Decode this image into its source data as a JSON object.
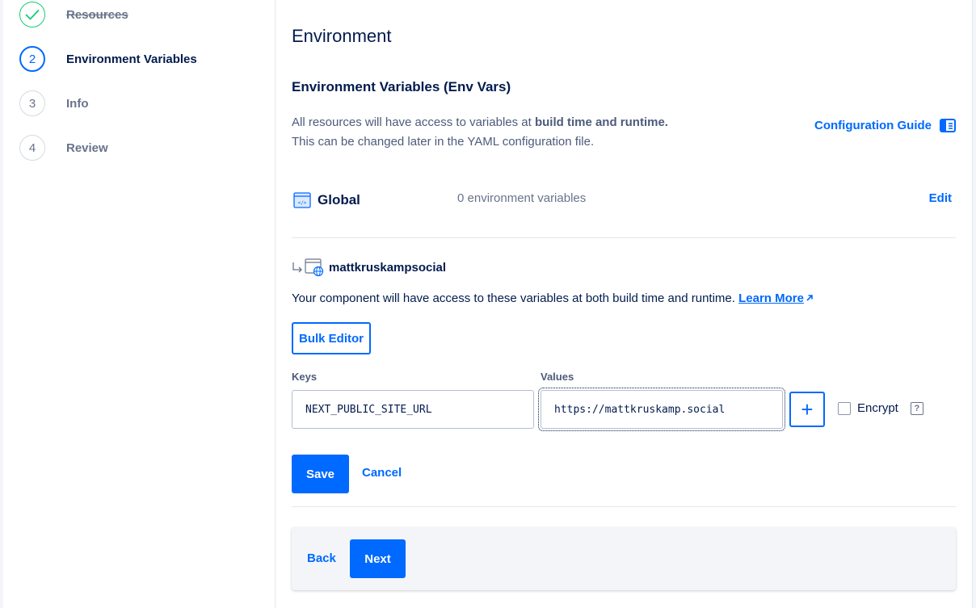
{
  "steps": [
    {
      "label": "Resources",
      "state": "done"
    },
    {
      "number": "2",
      "label": "Environment Variables",
      "state": "active"
    },
    {
      "number": "3",
      "label": "Info",
      "state": "pending"
    },
    {
      "number": "4",
      "label": "Review",
      "state": "pending"
    }
  ],
  "page": {
    "title": "Environment",
    "section_title": "Environment Variables (Env Vars)",
    "desc_prefix": "All resources will have access to variables at ",
    "desc_bold": "build time and runtime.",
    "desc_line2": "This can be changed later in the YAML configuration file.",
    "guide_link": "Configuration Guide"
  },
  "global": {
    "label": "Global",
    "count": "0 environment variables",
    "edit": "Edit"
  },
  "component": {
    "name": "mattkruskampsocial",
    "desc": "Your component will have access to these variables at both build time and runtime. ",
    "learn_more": "Learn More",
    "bulk_editor": "Bulk Editor",
    "keys_label": "Keys",
    "values_label": "Values",
    "key_value": "NEXT_PUBLIC_SITE_URL",
    "value_value": "https://mattkruskamp.social",
    "add_symbol": "+",
    "encrypt_label": "Encrypt",
    "help_symbol": "?",
    "save": "Save",
    "cancel": "Cancel"
  },
  "footer": {
    "back": "Back",
    "next": "Next"
  },
  "colors": {
    "accent": "#0069ff",
    "success": "#15cd72",
    "text": "#031b4e"
  }
}
